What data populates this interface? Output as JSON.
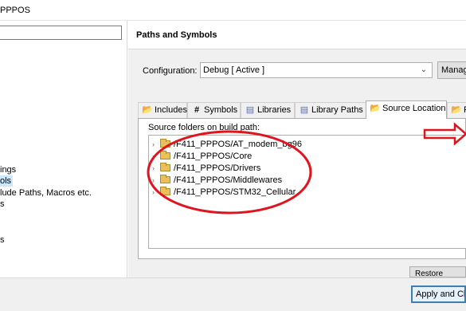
{
  "window": {
    "title": "PPPOS"
  },
  "left": {
    "items": [
      {
        "label": "ings"
      },
      {
        "label": "ols"
      },
      {
        "label": "lude Paths, Macros etc."
      },
      {
        "label": "s"
      },
      {
        "label": "s"
      }
    ]
  },
  "panel": {
    "title": "Paths and Symbols",
    "config_label": "Configuration:",
    "config_value": "Debug  [ Active ]",
    "manage_label": "Manag",
    "tabs": [
      {
        "label": "Includes",
        "icon": "includes-icon"
      },
      {
        "label": "Symbols",
        "icon": "hash-icon"
      },
      {
        "label": "Libraries",
        "icon": "libraries-icon"
      },
      {
        "label": "Library Paths",
        "icon": "library-paths-icon"
      },
      {
        "label": "Source Location",
        "icon": "folder-icon"
      },
      {
        "label": "R",
        "icon": "refs-icon"
      }
    ],
    "source_label": "Source folders on build path:",
    "folders": [
      "/F411_PPPOS/AT_modem_bg96",
      "/F411_PPPOS/Core",
      "/F411_PPPOS/Drivers",
      "/F411_PPPOS/Middlewares",
      "/F411_PPPOS/STM32_Cellular"
    ],
    "restore_label": "Restore Default"
  },
  "footer": {
    "apply_label": "Apply and Clo"
  },
  "colors": {
    "annotation": "#e0141e",
    "selection": "#cce8ff",
    "accent": "#3c7fb1"
  }
}
